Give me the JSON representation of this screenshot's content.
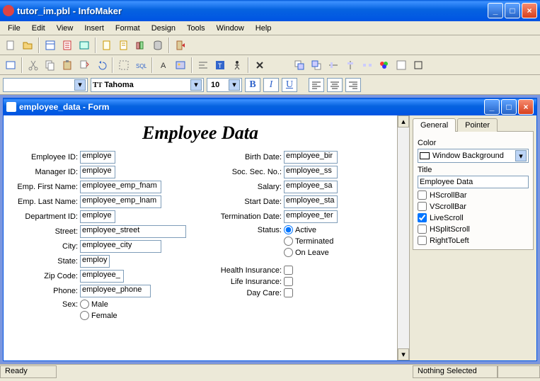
{
  "window": {
    "title": "tutor_im.pbl - InfoMaker"
  },
  "menu": [
    "File",
    "Edit",
    "View",
    "Insert",
    "Format",
    "Design",
    "Tools",
    "Window",
    "Help"
  ],
  "font": {
    "name": "Tahoma",
    "size": "10"
  },
  "child": {
    "title": "employee_data - Form"
  },
  "form": {
    "heading": "Employee Data",
    "labels": {
      "emp_id": "Employee ID:",
      "mgr_id": "Manager ID:",
      "fname": "Emp. First Name:",
      "lname": "Emp. Last Name:",
      "dept": "Department ID:",
      "street": "Street:",
      "city": "City:",
      "state": "State:",
      "zip": "Zip Code:",
      "phone": "Phone:",
      "sex": "Sex:",
      "bdate": "Birth Date:",
      "ssn": "Soc. Sec. No.:",
      "salary": "Salary:",
      "sdate": "Start Date:",
      "tdate": "Termination Date:",
      "status": "Status:",
      "hins": "Health Insurance:",
      "lins": "Life Insurance:",
      "dcare": "Day Care:"
    },
    "fields": {
      "emp_id": "employe",
      "mgr_id": "employe",
      "fname": "employee_emp_fnam",
      "lname": "employee_emp_lnam",
      "dept": "employe",
      "street": "employee_street",
      "city": "employee_city",
      "state": "employ",
      "zip": "employee_",
      "phone": "employee_phone",
      "bdate": "employee_bir",
      "ssn": "employee_ss",
      "salary": "employee_sa",
      "sdate": "employee_sta",
      "tdate": "employee_ter"
    },
    "sex": {
      "male": "Male",
      "female": "Female"
    },
    "status_opts": {
      "active": "Active",
      "term": "Terminated",
      "leave": "On Leave"
    }
  },
  "props": {
    "tabs": {
      "general": "General",
      "pointer": "Pointer"
    },
    "color_label": "Color",
    "color_value": "Window Background",
    "title_label": "Title",
    "title_value": "Employee Data",
    "checks": {
      "hscroll": "HScrollBar",
      "vscroll": "VScrollBar",
      "live": "LiveScroll",
      "hsplit": "HSplitScroll",
      "rtl": "RightToLeft"
    }
  },
  "statusbar": {
    "ready": "Ready",
    "sel": "Nothing Selected"
  }
}
